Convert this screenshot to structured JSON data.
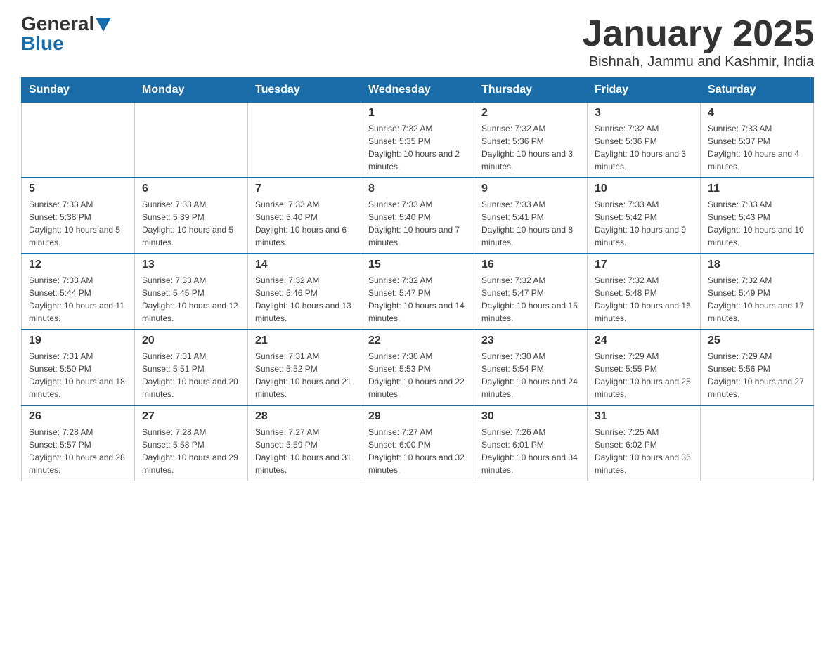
{
  "logo": {
    "general": "General",
    "blue": "Blue"
  },
  "header": {
    "title": "January 2025",
    "subtitle": "Bishnah, Jammu and Kashmir, India"
  },
  "days": {
    "headers": [
      "Sunday",
      "Monday",
      "Tuesday",
      "Wednesday",
      "Thursday",
      "Friday",
      "Saturday"
    ]
  },
  "weeks": [
    {
      "days": [
        {
          "number": "",
          "info": ""
        },
        {
          "number": "",
          "info": ""
        },
        {
          "number": "",
          "info": ""
        },
        {
          "number": "1",
          "info": "Sunrise: 7:32 AM\nSunset: 5:35 PM\nDaylight: 10 hours and 2 minutes."
        },
        {
          "number": "2",
          "info": "Sunrise: 7:32 AM\nSunset: 5:36 PM\nDaylight: 10 hours and 3 minutes."
        },
        {
          "number": "3",
          "info": "Sunrise: 7:32 AM\nSunset: 5:36 PM\nDaylight: 10 hours and 3 minutes."
        },
        {
          "number": "4",
          "info": "Sunrise: 7:33 AM\nSunset: 5:37 PM\nDaylight: 10 hours and 4 minutes."
        }
      ]
    },
    {
      "days": [
        {
          "number": "5",
          "info": "Sunrise: 7:33 AM\nSunset: 5:38 PM\nDaylight: 10 hours and 5 minutes."
        },
        {
          "number": "6",
          "info": "Sunrise: 7:33 AM\nSunset: 5:39 PM\nDaylight: 10 hours and 5 minutes."
        },
        {
          "number": "7",
          "info": "Sunrise: 7:33 AM\nSunset: 5:40 PM\nDaylight: 10 hours and 6 minutes."
        },
        {
          "number": "8",
          "info": "Sunrise: 7:33 AM\nSunset: 5:40 PM\nDaylight: 10 hours and 7 minutes."
        },
        {
          "number": "9",
          "info": "Sunrise: 7:33 AM\nSunset: 5:41 PM\nDaylight: 10 hours and 8 minutes."
        },
        {
          "number": "10",
          "info": "Sunrise: 7:33 AM\nSunset: 5:42 PM\nDaylight: 10 hours and 9 minutes."
        },
        {
          "number": "11",
          "info": "Sunrise: 7:33 AM\nSunset: 5:43 PM\nDaylight: 10 hours and 10 minutes."
        }
      ]
    },
    {
      "days": [
        {
          "number": "12",
          "info": "Sunrise: 7:33 AM\nSunset: 5:44 PM\nDaylight: 10 hours and 11 minutes."
        },
        {
          "number": "13",
          "info": "Sunrise: 7:33 AM\nSunset: 5:45 PM\nDaylight: 10 hours and 12 minutes."
        },
        {
          "number": "14",
          "info": "Sunrise: 7:32 AM\nSunset: 5:46 PM\nDaylight: 10 hours and 13 minutes."
        },
        {
          "number": "15",
          "info": "Sunrise: 7:32 AM\nSunset: 5:47 PM\nDaylight: 10 hours and 14 minutes."
        },
        {
          "number": "16",
          "info": "Sunrise: 7:32 AM\nSunset: 5:47 PM\nDaylight: 10 hours and 15 minutes."
        },
        {
          "number": "17",
          "info": "Sunrise: 7:32 AM\nSunset: 5:48 PM\nDaylight: 10 hours and 16 minutes."
        },
        {
          "number": "18",
          "info": "Sunrise: 7:32 AM\nSunset: 5:49 PM\nDaylight: 10 hours and 17 minutes."
        }
      ]
    },
    {
      "days": [
        {
          "number": "19",
          "info": "Sunrise: 7:31 AM\nSunset: 5:50 PM\nDaylight: 10 hours and 18 minutes."
        },
        {
          "number": "20",
          "info": "Sunrise: 7:31 AM\nSunset: 5:51 PM\nDaylight: 10 hours and 20 minutes."
        },
        {
          "number": "21",
          "info": "Sunrise: 7:31 AM\nSunset: 5:52 PM\nDaylight: 10 hours and 21 minutes."
        },
        {
          "number": "22",
          "info": "Sunrise: 7:30 AM\nSunset: 5:53 PM\nDaylight: 10 hours and 22 minutes."
        },
        {
          "number": "23",
          "info": "Sunrise: 7:30 AM\nSunset: 5:54 PM\nDaylight: 10 hours and 24 minutes."
        },
        {
          "number": "24",
          "info": "Sunrise: 7:29 AM\nSunset: 5:55 PM\nDaylight: 10 hours and 25 minutes."
        },
        {
          "number": "25",
          "info": "Sunrise: 7:29 AM\nSunset: 5:56 PM\nDaylight: 10 hours and 27 minutes."
        }
      ]
    },
    {
      "days": [
        {
          "number": "26",
          "info": "Sunrise: 7:28 AM\nSunset: 5:57 PM\nDaylight: 10 hours and 28 minutes."
        },
        {
          "number": "27",
          "info": "Sunrise: 7:28 AM\nSunset: 5:58 PM\nDaylight: 10 hours and 29 minutes."
        },
        {
          "number": "28",
          "info": "Sunrise: 7:27 AM\nSunset: 5:59 PM\nDaylight: 10 hours and 31 minutes."
        },
        {
          "number": "29",
          "info": "Sunrise: 7:27 AM\nSunset: 6:00 PM\nDaylight: 10 hours and 32 minutes."
        },
        {
          "number": "30",
          "info": "Sunrise: 7:26 AM\nSunset: 6:01 PM\nDaylight: 10 hours and 34 minutes."
        },
        {
          "number": "31",
          "info": "Sunrise: 7:25 AM\nSunset: 6:02 PM\nDaylight: 10 hours and 36 minutes."
        },
        {
          "number": "",
          "info": ""
        }
      ]
    }
  ]
}
